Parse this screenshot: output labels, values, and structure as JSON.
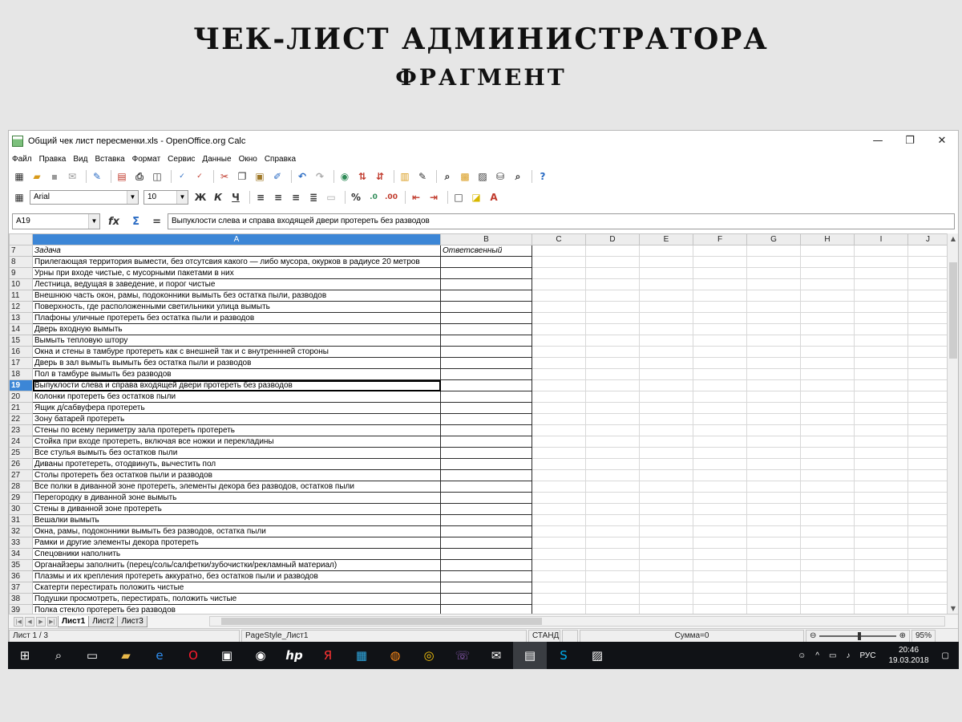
{
  "heading": {
    "title": "ЧЕК-ЛИСТ АДМИНИСТРАТОРА",
    "subtitle": "ФРАГМЕНТ"
  },
  "window": {
    "title": "Общий чек лист пересменки.xls - OpenOffice.org Calc",
    "controls": [
      "—",
      "❐",
      "✕"
    ]
  },
  "menu": [
    "Файл",
    "Правка",
    "Вид",
    "Вставка",
    "Формат",
    "Сервис",
    "Данные",
    "Окно",
    "Справка"
  ],
  "format_toolbar": {
    "font_name": "Arial",
    "font_size": "10",
    "bold": "Ж",
    "italic": "К",
    "underline": "Ч",
    "percent": "%"
  },
  "formula_bar": {
    "cell_ref": "A19",
    "fx": "fx",
    "sum": "Σ",
    "equals": "=",
    "content": "Выпуклости слева и справа входящей двери протереть без разводов"
  },
  "sheet": {
    "columns": [
      "A",
      "B",
      "C",
      "D",
      "E",
      "F",
      "G",
      "H",
      "I",
      "J"
    ],
    "selected_column": "A",
    "header_row": {
      "num": "7",
      "a": "Задача",
      "b": "Ответсвенный"
    },
    "selected_row": "19",
    "rows": [
      {
        "num": "8",
        "a": "Прилегающая территория вымести, без отсутсвия какого — либо мусора, окурков в радиусе 20 метров"
      },
      {
        "num": "9",
        "a": "Урны при входе чистые, с мусорными пакетами в них"
      },
      {
        "num": "10",
        "a": "Лестница, ведущая в заведение, и порог чистые"
      },
      {
        "num": "11",
        "a": "Внешнюю часть окон, рамы, подоконники  вымыть без остатка пыли, разводов"
      },
      {
        "num": "12",
        "a": "Поверхность, где расположенными светильники улица вымыть"
      },
      {
        "num": "13",
        "a": "Плафоны уличные протереть без остатка пыли и разводов"
      },
      {
        "num": "14",
        "a": "Дверь входную вымыть"
      },
      {
        "num": "15",
        "a": "Вымыть тепловую штору"
      },
      {
        "num": "16",
        "a": "Окна и стены в тамбуре протереть как с внешней так и с внутреннней стороны"
      },
      {
        "num": "17",
        "a": "Дверь в зал вымыть вымыть без остатка пыли и разводов"
      },
      {
        "num": "18",
        "a": "Пол в тамбуре вымыть без разводов"
      },
      {
        "num": "19",
        "a": "Выпуклости слева и справа входящей двери протереть без разводов"
      },
      {
        "num": "20",
        "a": "Колонки протереть без остатков пыли"
      },
      {
        "num": "21",
        "a": "Ящик д/сабвуфера протереть"
      },
      {
        "num": "22",
        "a": "Зону батарей протереть"
      },
      {
        "num": "23",
        "a": "Стены по всему периметру зала протереть протереть"
      },
      {
        "num": "24",
        "a": "Стойка при входе протереть, включая все ножки и перекладины"
      },
      {
        "num": "25",
        "a": "Все стулья вымыть без остатков пыли"
      },
      {
        "num": "26",
        "a": "Диваны протетереть, отодвинуть, вычестить пол"
      },
      {
        "num": "27",
        "a": "Столы протереть без остатков пыли и разводов"
      },
      {
        "num": "28",
        "a": "Все полки в диванной зоне протереть, элементы декора без разводов, остатков пыли"
      },
      {
        "num": "29",
        "a": "Перегородку в диванной зоне вымыть"
      },
      {
        "num": "30",
        "a": "Стены в диванной зоне протереть"
      },
      {
        "num": "31",
        "a": "Вешалки вымыть"
      },
      {
        "num": "32",
        "a": "Окна, рамы, подоконники вымыть без разводов, остатка пыли"
      },
      {
        "num": "33",
        "a": "Рамки и другие элементы декора протереть"
      },
      {
        "num": "34",
        "a": "Спецовники наполнить"
      },
      {
        "num": "35",
        "a": "Органайзеры заполнить (перец/соль/салфетки/зубочистки/рекламный материал)"
      },
      {
        "num": "36",
        "a": "Плазмы и их крепления протереть аккуратно, без остатков пыли и разводов"
      },
      {
        "num": "37",
        "a": "Скатерти перестирать положить чистые"
      },
      {
        "num": "38",
        "a": "Подушки просмотреть, перестирать, положить чистые"
      },
      {
        "num": "39",
        "a": "Полка стекло протереть без разводов"
      }
    ]
  },
  "tabs": [
    "Лист1",
    "Лист2",
    "Лист3"
  ],
  "active_tab": "Лист1",
  "status": {
    "sheet": "Лист 1 / 3",
    "style": "PageStyle_Лист1",
    "mode": "СТАНД",
    "sum": "Сумма=0",
    "zoom": "95%"
  },
  "taskbar": {
    "lang": "РУС",
    "time": "20:46",
    "date": "19.03.2018"
  }
}
